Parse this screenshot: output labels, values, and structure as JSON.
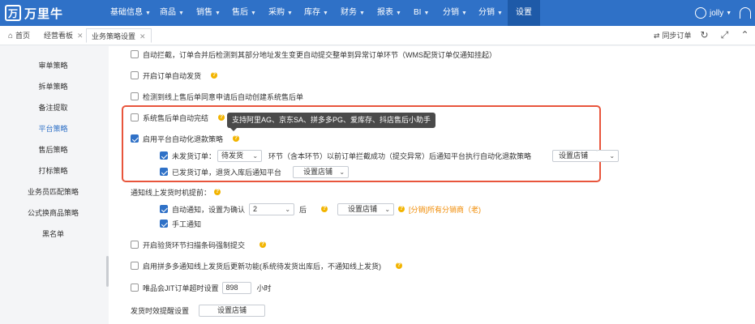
{
  "app": {
    "logo_mark": "万",
    "logo_text": "万里牛"
  },
  "nav": [
    {
      "label": "基础信息",
      "caret": true
    },
    {
      "label": "商品",
      "caret": true
    },
    {
      "label": "销售",
      "caret": true
    },
    {
      "label": "售后",
      "caret": true
    },
    {
      "label": "采购",
      "caret": true
    },
    {
      "label": "库存",
      "caret": true
    },
    {
      "label": "财务",
      "caret": true
    },
    {
      "label": "报表",
      "caret": true
    },
    {
      "label": "BI",
      "caret": true
    },
    {
      "label": "分销",
      "caret": true
    },
    {
      "label": "分销",
      "caret": true
    },
    {
      "label": "设置",
      "caret": false
    }
  ],
  "user": {
    "name": "jolly"
  },
  "tabs": [
    {
      "label": "首页",
      "closable": false
    },
    {
      "label": "经营看板",
      "closable": true
    },
    {
      "label": "业务策略设置",
      "closable": true
    }
  ],
  "toolbar": {
    "sync_orders": "同步订单"
  },
  "sidebar": {
    "items": [
      "审单策略",
      "拆单策略",
      "备注提取",
      "平台策略",
      "售后策略",
      "打标策略",
      "业务员匹配策略",
      "公式换商品策略",
      "黑名单"
    ],
    "active": "平台策略"
  },
  "settings": {
    "auto_intercept": {
      "label": "自动拦截，订单合并后检测到其部分地址发生变更自动提交整单到异常订单环节（WMS配货订单仅通知挂起）",
      "checked": false
    },
    "auto_ship": {
      "label": "开启订单自动发货",
      "checked": false
    },
    "auto_aftersale": {
      "label": "检测到线上售后单同意申请后自动创建系统售后单",
      "checked": false
    },
    "aftersale_complete": {
      "label": "系统售后单自动完结",
      "checked": false
    },
    "auto_refund": {
      "label": "启用平台自动化退款策略",
      "checked": true
    },
    "tooltip": "支持阿里AG、京东SA、拼多多PG、爱库存、抖店售后小助手",
    "unshipped": {
      "label": "未发货订单：",
      "checked": true,
      "select_value": "待发货",
      "text": "环节（含本环节）以前订单拦截成功（提交异常）后通知平台执行自动化退款策略",
      "button": "设置店铺"
    },
    "shipped": {
      "label": "已发货订单，退货入库后通知平台",
      "checked": true,
      "button": "设置店铺"
    },
    "notify_title": "通知线上发货时机提前：",
    "auto_notify": {
      "label": "自动通知，设置为确认",
      "checked": true,
      "select_value": "2",
      "suffix": "后",
      "button": "设置店铺",
      "note": "[分销]所有分销商（老)"
    },
    "manual_notify": {
      "label": "手工通知",
      "checked": true
    },
    "scan_force": {
      "label": "开启验货环节扫描条码强制提交",
      "checked": false
    },
    "pdd_notify": {
      "label": "启用拼多多通知线上发货后更新功能(系统待发货出库后，不通知线上发货)",
      "checked": false
    },
    "vip_jit": {
      "label": "唯品会JIT订单超时设置",
      "checked": false,
      "value": "898",
      "unit": "小时"
    },
    "ship_reminder": {
      "label": "发货时效提醒设置",
      "button": "设置店铺"
    }
  },
  "colors": {
    "brand": "#2f71c7",
    "highlight_border": "#e8553c",
    "help_icon": "#f2b400",
    "note": "#f08a00"
  }
}
